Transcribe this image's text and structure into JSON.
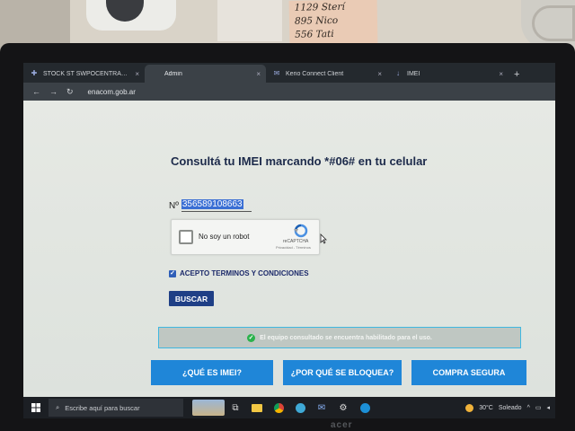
{
  "background": {
    "note_lines": [
      "1129 Sterí",
      "895 Nico",
      "556 Tati"
    ]
  },
  "browser": {
    "tabs": [
      {
        "title": "STOCK ST SWPOCENTRAL · M",
        "icon": "plus-icon",
        "active": false
      },
      {
        "title": "Admin",
        "icon": "blank-page-icon",
        "active": true
      },
      {
        "title": "Kerio Connect Client",
        "icon": "mail-icon",
        "active": false
      },
      {
        "title": "IMEI",
        "icon": "download-icon",
        "active": false
      }
    ],
    "tab_close": "×",
    "new_tab": "+",
    "url": "enacom.gob.ar"
  },
  "page": {
    "title": "Consultá tu IMEI marcando *#06# en tu celular",
    "imei_label": "Nº",
    "imei_value": "356589108663",
    "recaptcha": {
      "label": "No soy un robot",
      "brand": "reCAPTCHA",
      "links": "Privacidad - Términos"
    },
    "terms_label": "ACEPTO TERMINOS Y CONDICIONES",
    "terms_checked": true,
    "search_button": "BUSCAR",
    "result_message": "El equipo consultado se encuentra habilitado para el uso.",
    "cta_buttons": [
      "¿QUÉ ES IMEI?",
      "¿POR QUÉ SE BLOQUEA?",
      "COMPRA SEGURA"
    ]
  },
  "taskbar": {
    "search_placeholder": "Escribe aquí para buscar",
    "weather_temp": "30°C",
    "weather_text": "Soleado",
    "icons": [
      "task-view-icon",
      "file-explorer-icon",
      "chrome-icon",
      "edge-icon",
      "mail-icon",
      "settings-icon",
      "edge-blue-icon"
    ]
  },
  "monitor": {
    "brand": "acer"
  },
  "colors": {
    "navy": "#1c2a4a",
    "button_dark": "#1f3f86",
    "cta_blue": "#1f86d8",
    "success_green": "#2bb24c",
    "selection_blue": "#3b6fd4"
  }
}
